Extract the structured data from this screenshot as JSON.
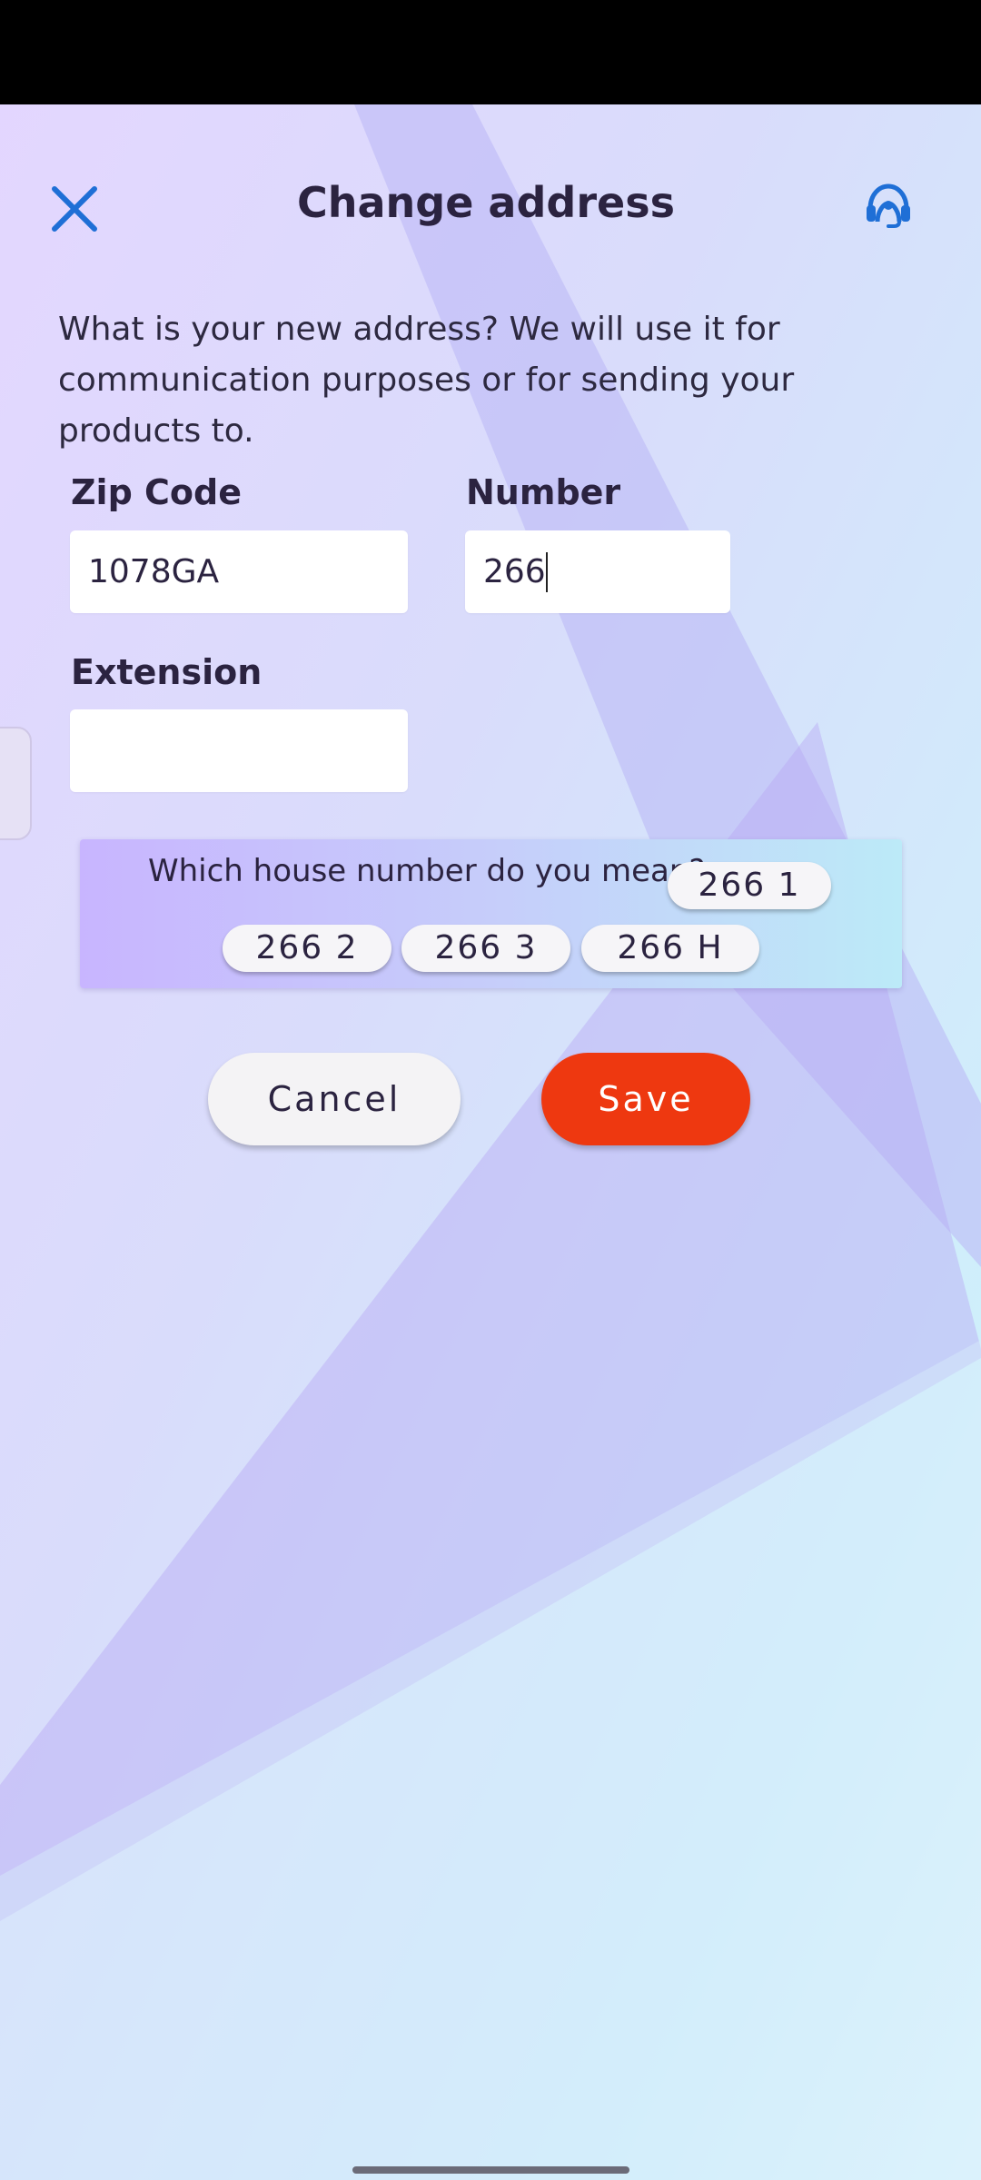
{
  "header": {
    "title": "Change address",
    "close_icon": "close-icon",
    "support_icon": "headset-support-icon"
  },
  "intro_text": "What is your new address? We will use it for communication purposes or for sending your products to.",
  "form": {
    "zip": {
      "label": "Zip Code",
      "value": "1078GA"
    },
    "number": {
      "label": "Number",
      "value": "266"
    },
    "extension": {
      "label": "Extension",
      "value": ""
    }
  },
  "suggestions": {
    "question": "Which house number do you mean?",
    "options": [
      "266 1",
      "266 2",
      "266 3",
      "266 H"
    ]
  },
  "actions": {
    "cancel_label": "Cancel",
    "save_label": "Save"
  },
  "colors": {
    "accent": "#1f6fd6",
    "save_button": "#ee3810",
    "text": "#2b2340"
  }
}
